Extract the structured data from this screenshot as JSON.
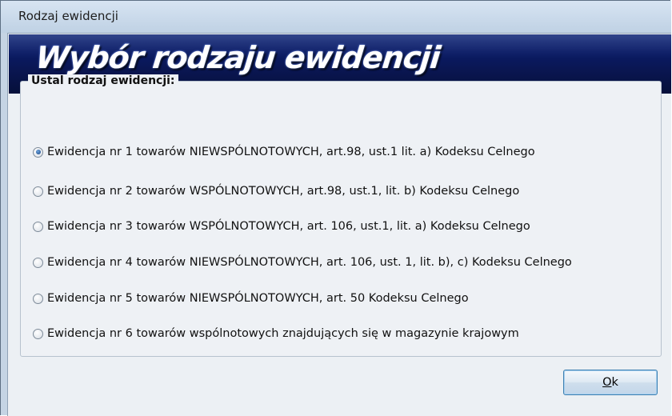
{
  "window": {
    "title": "Rodzaj ewidencji"
  },
  "banner": {
    "heading": "Wybór rodzaju ewidencji"
  },
  "group": {
    "legend": "Ustal rodzaj ewidencji:",
    "selected_index": 0,
    "options": [
      "Ewidencja nr 1 towarów NIEWSPÓLNOTOWYCH, art.98, ust.1 lit. a) Kodeksu Celnego",
      "Ewidencja nr 2 towarów WSPÓLNOTOWYCH, art.98, ust.1, lit. b) Kodeksu Celnego",
      "Ewidencja nr 3 towarów WSPÓLNOTOWYCH, art. 106, ust.1, lit. a) Kodeksu Celnego",
      "Ewidencja nr 4 towarów NIEWSPÓLNOTOWYCH, art. 106, ust. 1, lit. b), c) Kodeksu Celnego",
      "Ewidencja nr 5 towarów NIEWSPÓLNOTOWYCH, art. 50 Kodeksu Celnego",
      "Ewidencja nr 6 towarów wspólnotowych znajdujących się w magazynie krajowym"
    ]
  },
  "buttons": {
    "ok_mnemonic": "O",
    "ok_rest": "k"
  },
  "colors": {
    "banner": "#0a1b66",
    "accent": "#3c7fb1"
  }
}
